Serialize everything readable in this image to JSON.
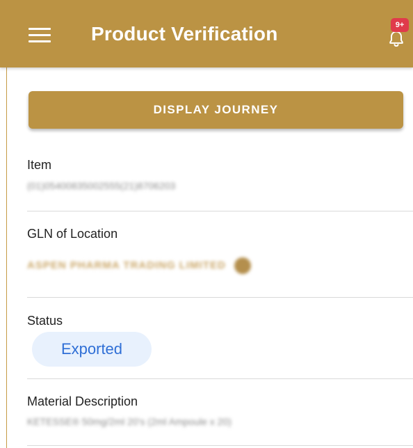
{
  "header": {
    "title": "Product Verification",
    "notification_badge": "9+",
    "background_color": "#bb9344"
  },
  "actions": {
    "display_journey_label": "DISPLAY JOURNEY"
  },
  "fields": {
    "item": {
      "label": "Item",
      "value": "(01)05400835002555(21)8706203"
    },
    "gln": {
      "label": "GLN of Location",
      "value": "ASPEN PHARMA TRADING LIMITED"
    },
    "status": {
      "label": "Status",
      "value": "Exported",
      "chip_color": "#e8f1fd",
      "text_color": "#2f6fd6"
    },
    "material": {
      "label": "Material Description",
      "value": "KETESSE® 50mg/2ml 20's (2ml Ampoule x 20)"
    }
  }
}
